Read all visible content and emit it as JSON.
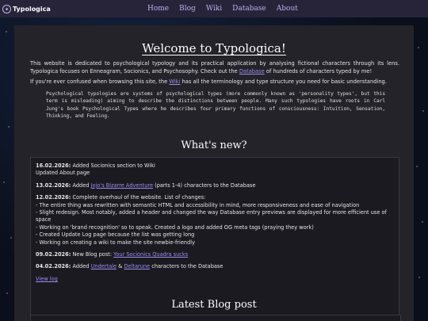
{
  "header": {
    "site_name": "Typologica",
    "nav": [
      "Home",
      "Blog",
      "Wiki",
      "Database",
      "About"
    ]
  },
  "main": {
    "title": "Welcome to Typologica!",
    "intro_1a": "This website is dedicated to psychological typology and its practical application by analysing fictional characters through its lens. Typologica focuses on Enneagram, Socionics, and Psychosophy. Check out the ",
    "intro_1_link": "Database",
    "intro_1b": " of hundreds of characters typed by me!",
    "intro_2a": "If you're ever confused when browsing this site, the ",
    "intro_2_link": "Wiki",
    "intro_2b": " has all the terminology and type structure you need for basic understanding.",
    "quote": "Psychological typologies are systems of psychological types (more commonly known as 'personality types', but this term is misleading) aiming to describe the distinctions between people. Many such typologies have roots in Carl Jung's book Psychological Types where he describes four primary functions of consciousness: Intuition, Sensation, Thinking, and Feeling.",
    "whats_new_title": "What's new?",
    "news": {
      "e1_date": "16.02.2026:",
      "e1_text": " Added Socionics section to Wiki",
      "e1_line2": "Updated About page",
      "e2_date": "13.02.2026:",
      "e2_pre": " Added ",
      "e2_link": "Jojo's Bizarre Adventure",
      "e2_post": " (parts 1-4) characters to the Database",
      "e3_date": "12.02.2026:",
      "e3_text": " Complete overhaul of the website. List of changes:",
      "e3_items": [
        "- The entire thing was rewritten with semantic HTML and accessibility in mind, more responsiveness and ease of navigation",
        "- Slight redesign. Most notably, added a header and changed the way Database entry previews are displayed for more efficient use of space",
        "- Working on 'brand recognition' so to speak. Created a logo and added OG meta tags (praying they work)",
        "- Created Update Log page because the list was getting long",
        "- Working on creating a wiki to make the site newbie-friendly"
      ],
      "e4_date": "09.02.2026:",
      "e4_pre": " New Blog post: ",
      "e4_link": "Your Socionics Quadra sucks",
      "e5_date": "04.02.2026:",
      "e5_pre": " Added ",
      "e5_link1": "Undertale",
      "e5_mid": " & ",
      "e5_link2": "Deltarune",
      "e5_post": " characters to the Database",
      "view_log": "View log"
    },
    "latest_blog_title": "Latest Blog post"
  }
}
